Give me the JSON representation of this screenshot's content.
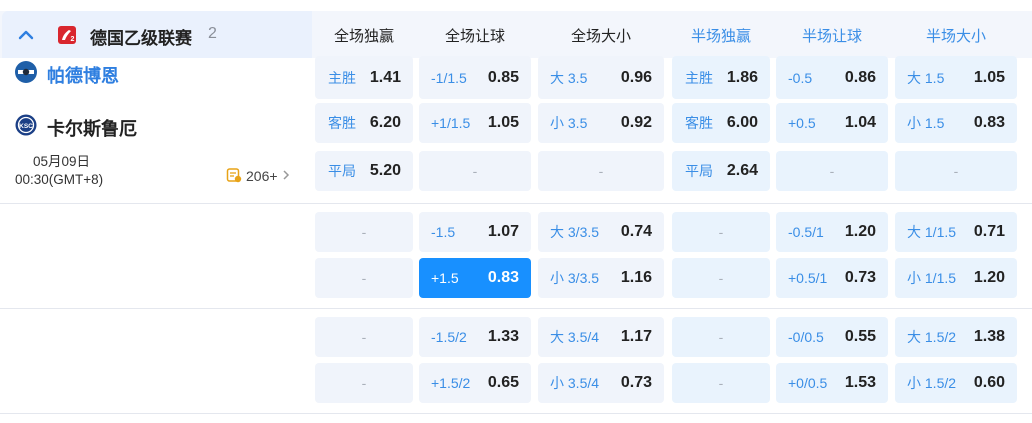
{
  "league": {
    "name": "德国乙级联赛",
    "count": "2"
  },
  "columns": [
    "全场独赢",
    "全场让球",
    "全场大小",
    "半场独赢",
    "半场让球",
    "半场大小"
  ],
  "match": {
    "home": "帕德博恩",
    "away": "卡尔斯鲁厄",
    "date": "05月09日",
    "time": "00:30(GMT+8)",
    "bet_count": "206+"
  },
  "dash": "-",
  "rows": [
    {
      "cells": [
        {
          "label": "主胜",
          "value": "1.41"
        },
        {
          "label": "-1/1.5",
          "value": "0.85"
        },
        {
          "label": "大 3.5",
          "value": "0.96"
        },
        {
          "label": "主胜",
          "value": "1.86"
        },
        {
          "label": "-0.5",
          "value": "0.86"
        },
        {
          "label": "大 1.5",
          "value": "1.05"
        }
      ]
    },
    {
      "cells": [
        {
          "label": "客胜",
          "value": "6.20"
        },
        {
          "label": "+1/1.5",
          "value": "1.05"
        },
        {
          "label": "小 3.5",
          "value": "0.92"
        },
        {
          "label": "客胜",
          "value": "6.00"
        },
        {
          "label": "+0.5",
          "value": "1.04"
        },
        {
          "label": "小 1.5",
          "value": "0.83"
        }
      ]
    },
    {
      "cells": [
        {
          "label": "平局",
          "value": "5.20"
        },
        null,
        null,
        {
          "label": "平局",
          "value": "2.64"
        },
        null,
        null
      ]
    },
    {
      "cells": [
        null,
        {
          "label": "-1.5",
          "value": "1.07"
        },
        {
          "label": "大 3/3.5",
          "value": "0.74"
        },
        null,
        {
          "label": "-0.5/1",
          "value": "1.20"
        },
        {
          "label": "大 1/1.5",
          "value": "0.71"
        }
      ]
    },
    {
      "cells": [
        null,
        {
          "label": "+1.5",
          "value": "0.83",
          "selected": true
        },
        {
          "label": "小 3/3.5",
          "value": "1.16"
        },
        null,
        {
          "label": "+0.5/1",
          "value": "0.73"
        },
        {
          "label": "小 1/1.5",
          "value": "1.20"
        }
      ]
    },
    {
      "cells": [
        null,
        {
          "label": "-1.5/2",
          "value": "1.33"
        },
        {
          "label": "大 3.5/4",
          "value": "1.17"
        },
        null,
        {
          "label": "-0/0.5",
          "value": "0.55"
        },
        {
          "label": "大 1.5/2",
          "value": "1.38"
        }
      ]
    },
    {
      "cells": [
        null,
        {
          "label": "+1.5/2",
          "value": "0.65"
        },
        {
          "label": "小 3.5/4",
          "value": "0.73"
        },
        null,
        {
          "label": "+0/0.5",
          "value": "1.53"
        },
        {
          "label": "小 1.5/2",
          "value": "0.60"
        }
      ]
    }
  ],
  "colors": {
    "accent": "#1890ff",
    "label_blue": "#3a8ee6"
  },
  "icons": {
    "collapse": "chevron-up-icon",
    "league_logo": "bundesliga-2-logo-icon",
    "bets": "coupon-icon",
    "more": "chevron-right-icon"
  }
}
